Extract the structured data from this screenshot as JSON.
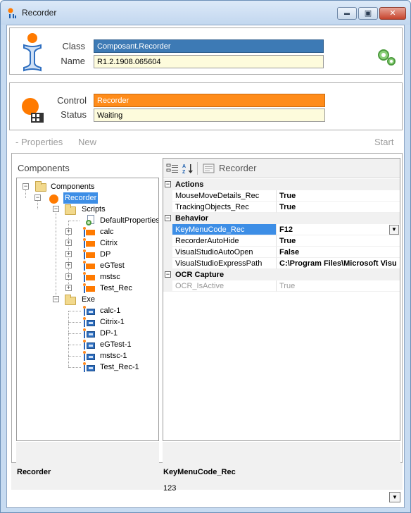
{
  "window": {
    "title": "Recorder",
    "buttons": {
      "minimize": "▬",
      "maximize": "▣",
      "close": "✕"
    }
  },
  "header": {
    "class_label": "Class",
    "class_value": "Composant.Recorder",
    "name_label": "Name",
    "name_value": "R1.2.1908.065604",
    "settings_icon": "gears-icon"
  },
  "control_box": {
    "control_label": "Control",
    "control_value": "Recorder",
    "status_label": "Status",
    "status_value": "Waiting"
  },
  "toolbar": {
    "properties": "- Properties",
    "new": "New",
    "start": "Start"
  },
  "components": {
    "header": "Components",
    "tree": {
      "root": "Components",
      "recorder": "Recorder",
      "scripts": "Scripts",
      "scripts_items": [
        "DefaultProperties",
        "calc",
        "Citrix",
        "DP",
        "eGTest",
        "mstsc",
        "Test_Rec"
      ],
      "exe": "Exe",
      "exe_items": [
        "calc-1",
        "Citrix-1",
        "DP-1",
        "eGTest-1",
        "mstsc-1",
        "Test_Rec-1"
      ]
    }
  },
  "property_grid": {
    "title": "Recorder",
    "categories": [
      {
        "name": "Actions",
        "rows": [
          {
            "name": "MouseMoveDetails_Rec",
            "value": "True"
          },
          {
            "name": "TrackingObjects_Rec",
            "value": "True"
          }
        ]
      },
      {
        "name": "Behavior",
        "rows": [
          {
            "name": "KeyMenuCode_Rec",
            "value": "F12"
          },
          {
            "name": "RecorderAutoHide",
            "value": "True"
          },
          {
            "name": "VisualStudioAutoOpen",
            "value": "False"
          },
          {
            "name": "VisualStudioExpressPath",
            "value": "C:\\Program Files\\Microsoft Visu"
          }
        ]
      },
      {
        "name": "OCR Capture",
        "rows": [
          {
            "name": "OCR_IsActive",
            "value": "True"
          }
        ]
      }
    ]
  },
  "description": {
    "left_title": "Recorder",
    "right_title": "KeyMenuCode_Rec",
    "right_text": "123"
  },
  "colors": {
    "selection_blue": "#3d7ab5",
    "orange": "#ff8c1a",
    "cream": "#fdfbdc"
  }
}
